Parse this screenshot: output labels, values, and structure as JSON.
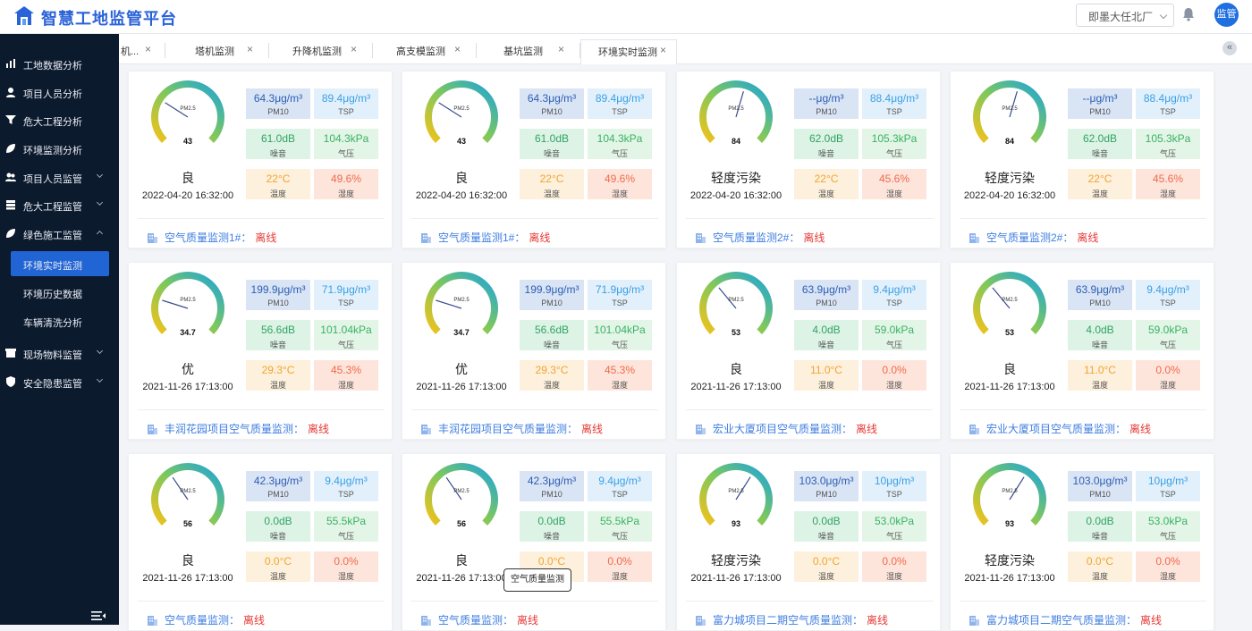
{
  "header": {
    "title": "智慧工地监管平台",
    "site": "即墨大任北厂",
    "user": "监管"
  },
  "sidebar": {
    "items": [
      {
        "label": "工地数据分析",
        "icon": "chart-icon"
      },
      {
        "label": "项目人员分析",
        "icon": "user-icon"
      },
      {
        "label": "危大工程分析",
        "icon": "filter-icon"
      },
      {
        "label": "环境监测分析",
        "icon": "leaf-icon"
      },
      {
        "label": "项目人员监管",
        "icon": "users-icon"
      },
      {
        "label": "危大工程监管",
        "icon": "stack-icon"
      },
      {
        "label": "绿色施工监管",
        "icon": "leaf-icon"
      },
      {
        "label": "现场物料监管",
        "icon": "box-icon"
      },
      {
        "label": "安全隐患监管",
        "icon": "shield-icon"
      }
    ],
    "subitems": [
      {
        "label": "环境实时监测"
      },
      {
        "label": "环境历史数据"
      },
      {
        "label": "车辆清洗分析"
      }
    ]
  },
  "tabs": [
    {
      "label": "机..."
    },
    {
      "label": "塔机监测"
    },
    {
      "label": "升降机监测"
    },
    {
      "label": "高支模监测"
    },
    {
      "label": "基坑监测"
    },
    {
      "label": "环境实时监测"
    }
  ],
  "metric_names": {
    "pm25": "PM2.5",
    "pm10": "PM10",
    "tsp": "TSP",
    "noise": "噪音",
    "pressure": "气压",
    "temp": "温度",
    "humidity": "湿度"
  },
  "cards": [
    {
      "aqi": "43",
      "aqi_value": 43,
      "level": "良",
      "time": "2022-04-20 16:32:00",
      "pm10": "64.3μg/m³",
      "tsp": "89.4μg/m³",
      "noise": "61.0dB",
      "pressure": "104.3kPa",
      "temp": "22°C",
      "humidity": "49.6%",
      "name": "空气质量监测1#：",
      "status": "离线"
    },
    {
      "aqi": "43",
      "aqi_value": 43,
      "level": "良",
      "time": "2022-04-20 16:32:00",
      "pm10": "64.3μg/m³",
      "tsp": "89.4μg/m³",
      "noise": "61.0dB",
      "pressure": "104.3kPa",
      "temp": "22°C",
      "humidity": "49.6%",
      "name": "空气质量监测1#：",
      "status": "离线"
    },
    {
      "aqi": "84",
      "aqi_value": 84,
      "level": "轻度污染",
      "time": "2022-04-20 16:32:00",
      "pm10": "--μg/m³",
      "tsp": "88.4μg/m³",
      "noise": "62.0dB",
      "pressure": "105.3kPa",
      "temp": "22°C",
      "humidity": "45.6%",
      "name": "空气质量监测2#：",
      "status": "离线"
    },
    {
      "aqi": "84",
      "aqi_value": 84,
      "level": "轻度污染",
      "time": "2022-04-20 16:32:00",
      "pm10": "--μg/m³",
      "tsp": "88.4μg/m³",
      "noise": "62.0dB",
      "pressure": "105.3kPa",
      "temp": "22°C",
      "humidity": "45.6%",
      "name": "空气质量监测2#：",
      "status": "离线"
    },
    {
      "aqi": "34.7",
      "aqi_value": 34.7,
      "level": "优",
      "time": "2021-11-26 17:13:00",
      "pm10": "199.9μg/m³",
      "tsp": "71.9μg/m³",
      "noise": "56.6dB",
      "pressure": "101.04kPa",
      "temp": "29.3°C",
      "humidity": "45.3%",
      "name": "丰润花园项目空气质量监测：",
      "status": "离线"
    },
    {
      "aqi": "34.7",
      "aqi_value": 34.7,
      "level": "优",
      "time": "2021-11-26 17:13:00",
      "pm10": "199.9μg/m³",
      "tsp": "71.9μg/m³",
      "noise": "56.6dB",
      "pressure": "101.04kPa",
      "temp": "29.3°C",
      "humidity": "45.3%",
      "name": "丰润花园项目空气质量监测：",
      "status": "离线"
    },
    {
      "aqi": "53",
      "aqi_value": 53,
      "level": "良",
      "time": "2021-11-26 17:13:00",
      "pm10": "63.9μg/m³",
      "tsp": "9.4μg/m³",
      "noise": "4.0dB",
      "pressure": "59.0kPa",
      "temp": "11.0°C",
      "humidity": "0.0%",
      "name": "宏业大厦项目空气质量监测：",
      "status": "离线"
    },
    {
      "aqi": "53",
      "aqi_value": 53,
      "level": "良",
      "time": "2021-11-26 17:13:00",
      "pm10": "63.9μg/m³",
      "tsp": "9.4μg/m³",
      "noise": "4.0dB",
      "pressure": "59.0kPa",
      "temp": "11.0°C",
      "humidity": "0.0%",
      "name": "宏业大厦项目空气质量监测：",
      "status": "离线"
    },
    {
      "aqi": "56",
      "aqi_value": 56,
      "level": "良",
      "time": "2021-11-26 17:13:00",
      "pm10": "42.3μg/m³",
      "tsp": "9.4μg/m³",
      "noise": "0.0dB",
      "pressure": "55.5kPa",
      "temp": "0.0°C",
      "humidity": "0.0%",
      "name": "空气质量监测：",
      "status": "离线"
    },
    {
      "aqi": "56",
      "aqi_value": 56,
      "level": "良",
      "time": "2021-11-26 17:13:00",
      "pm10": "42.3μg/m³",
      "tsp": "9.4μg/m³",
      "noise": "0.0dB",
      "pressure": "55.5kPa",
      "temp": "0.0°C",
      "humidity": "0.0%",
      "name": "空气质量监测：",
      "status": "离线"
    },
    {
      "aqi": "93",
      "aqi_value": 93,
      "level": "轻度污染",
      "time": "2021-11-26 17:13:00",
      "pm10": "103.0μg/m³",
      "tsp": "10μg/m³",
      "noise": "0.0dB",
      "pressure": "53.0kPa",
      "temp": "0.0°C",
      "humidity": "0.0%",
      "name": "富力城项目二期空气质量监测：",
      "status": "离线"
    },
    {
      "aqi": "93",
      "aqi_value": 93,
      "level": "轻度污染",
      "time": "2021-11-26 17:13:00",
      "pm10": "103.0μg/m³",
      "tsp": "10μg/m³",
      "noise": "0.0dB",
      "pressure": "53.0kPa",
      "temp": "0.0°C",
      "humidity": "0.0%",
      "name": "富力城项目二期空气质量监测：",
      "status": "离线"
    }
  ],
  "tooltip": "空气质量监测",
  "colors": {
    "accent": "#2164d4",
    "sidebar_bg": "#0c1a2e",
    "offline": "#e53935",
    "link": "#3d7de0"
  }
}
